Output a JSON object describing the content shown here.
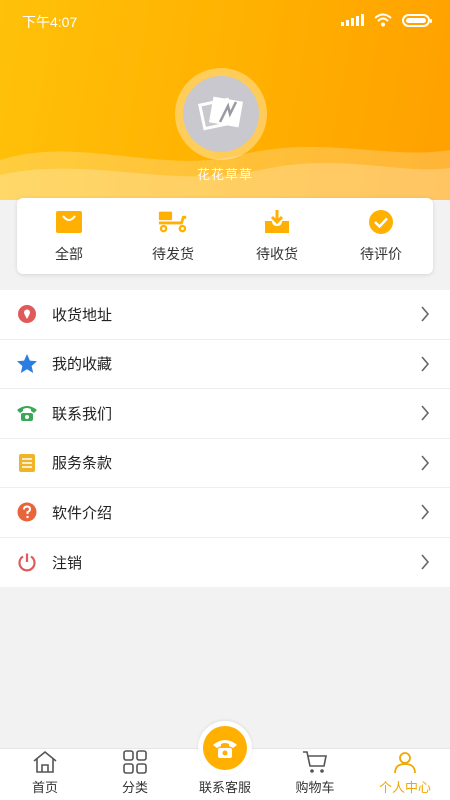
{
  "status_bar": {
    "time": "下午4:07",
    "icons": [
      "signal-icon",
      "wifi-icon",
      "battery-icon"
    ]
  },
  "profile": {
    "username": "花花草草",
    "avatar_icon": "photo-placeholder-icon"
  },
  "orders": [
    {
      "label": "全部",
      "icon": "bag-icon"
    },
    {
      "label": "待发货",
      "icon": "delivery-scooter-icon"
    },
    {
      "label": "待收货",
      "icon": "inbox-download-icon"
    },
    {
      "label": "待评价",
      "icon": "check-circle-icon"
    }
  ],
  "menu": [
    {
      "label": "收货地址",
      "icon": "location-pin-icon",
      "color": "#e05a5a"
    },
    {
      "label": "我的收藏",
      "icon": "star-icon",
      "color": "#2a7de1"
    },
    {
      "label": "联系我们",
      "icon": "phone-icon",
      "color": "#3aa857"
    },
    {
      "label": "服务条款",
      "icon": "document-icon",
      "color": "#f0b429"
    },
    {
      "label": "软件介绍",
      "icon": "question-icon",
      "color": "#e8643a"
    },
    {
      "label": "注销",
      "icon": "power-icon",
      "color": "#e05a5a"
    }
  ],
  "tabbar": [
    {
      "label": "首页",
      "icon": "home-icon"
    },
    {
      "label": "分类",
      "icon": "grid-icon"
    },
    {
      "label": "联系客服",
      "icon": "phone-icon"
    },
    {
      "label": "购物车",
      "icon": "cart-icon"
    },
    {
      "label": "个人中心",
      "icon": "user-icon",
      "active": true
    }
  ],
  "colors": {
    "brand": "#ffb000",
    "accent": "#f0a800",
    "background": "#f2f2f2"
  }
}
